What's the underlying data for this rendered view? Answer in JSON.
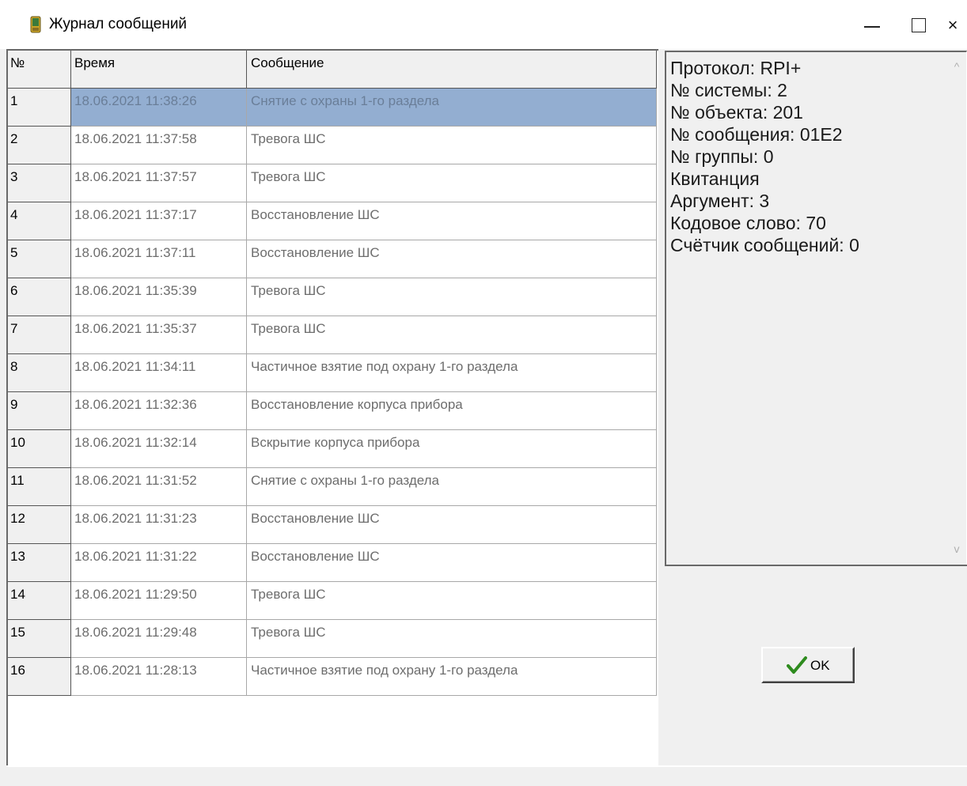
{
  "window": {
    "title": "Журнал сообщений",
    "minimize": "–",
    "close": "×"
  },
  "grid": {
    "headers": {
      "num": "№",
      "time": "Время",
      "message": "Сообщение"
    },
    "rows": [
      {
        "num": "1",
        "time": "18.06.2021 11:38:26",
        "message": "Снятие с охраны 1-го раздела"
      },
      {
        "num": "2",
        "time": "18.06.2021 11:37:58",
        "message": "Тревога ШС"
      },
      {
        "num": "3",
        "time": "18.06.2021 11:37:57",
        "message": "Тревога ШС"
      },
      {
        "num": "4",
        "time": "18.06.2021 11:37:17",
        "message": "Восстановление ШС"
      },
      {
        "num": "5",
        "time": "18.06.2021 11:37:11",
        "message": "Восстановление ШС"
      },
      {
        "num": "6",
        "time": "18.06.2021 11:35:39",
        "message": "Тревога ШС"
      },
      {
        "num": "7",
        "time": "18.06.2021 11:35:37",
        "message": "Тревога ШС"
      },
      {
        "num": "8",
        "time": "18.06.2021 11:34:11",
        "message": "Частичное взятие под охрану 1-го раздела"
      },
      {
        "num": "9",
        "time": "18.06.2021 11:32:36",
        "message": "Восстановление корпуса прибора"
      },
      {
        "num": "10",
        "time": "18.06.2021 11:32:14",
        "message": "Вскрытие корпуса прибора"
      },
      {
        "num": "11",
        "time": "18.06.2021 11:31:52",
        "message": "Снятие с охраны 1-го раздела"
      },
      {
        "num": "12",
        "time": "18.06.2021 11:31:23",
        "message": "Восстановление ШС"
      },
      {
        "num": "13",
        "time": "18.06.2021 11:31:22",
        "message": "Восстановление ШС"
      },
      {
        "num": "14",
        "time": "18.06.2021 11:29:50",
        "message": "Тревога ШС"
      },
      {
        "num": "15",
        "time": "18.06.2021 11:29:48",
        "message": "Тревога ШС"
      },
      {
        "num": "16",
        "time": "18.06.2021 11:28:13",
        "message": "Частичное взятие под охрану 1-го раздела"
      }
    ],
    "selected_row": "1"
  },
  "details": {
    "lines": [
      "Протокол: RPI+",
      "№ системы: 2",
      "№ объекта: 201",
      "№ сообщения: 01E2",
      "№ группы: 0",
      "Квитанция",
      "Аргумент: 3",
      "Кодовое слово: 70",
      "Счётчик сообщений: 0"
    ]
  },
  "ok_button": {
    "label": "OK"
  },
  "colors": {
    "selection": "#93aed1",
    "check": "#2e8b1e"
  }
}
